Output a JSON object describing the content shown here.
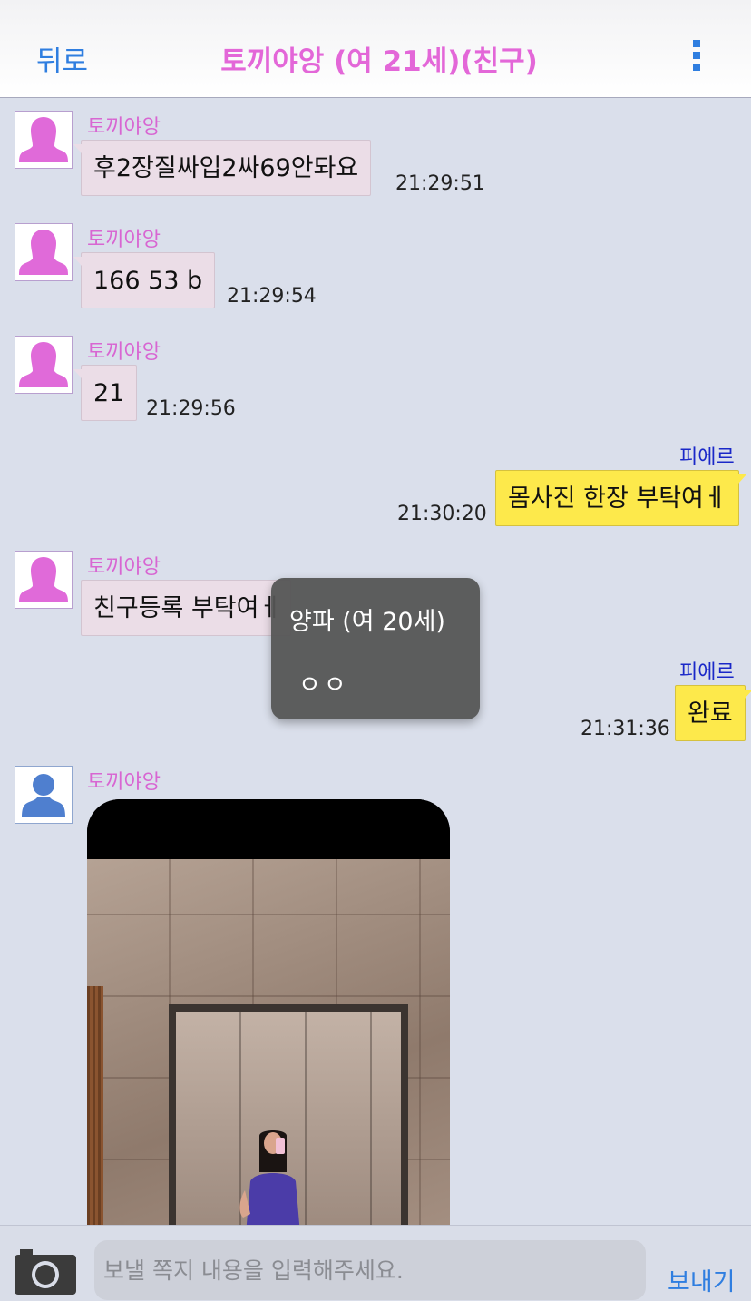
{
  "header": {
    "back_label": "뒤로",
    "title": "토끼야앙 (여 21세)(친구)",
    "menu_icon": "more-vertical-icon"
  },
  "colors": {
    "accent": "#2f7ee0",
    "partner_name": "#d866d2",
    "my_name": "#1a28c8",
    "incoming_bubble": "#ebdde7",
    "outgoing_bubble": "#fde94b"
  },
  "messages": [
    {
      "sender": "토끼야앙",
      "text": "후2장질싸입2싸69안돠요",
      "time": "21:29:51",
      "direction": "in"
    },
    {
      "sender": "토끼야앙",
      "text": "166 53 b",
      "time": "21:29:54",
      "direction": "in"
    },
    {
      "sender": "토끼야앙",
      "text": "21",
      "time": "21:29:56",
      "direction": "in"
    },
    {
      "sender": "피에르",
      "text": "몸사진 한장 부탁여ㅔ",
      "time": "21:30:20",
      "direction": "out"
    },
    {
      "sender": "토끼야앙",
      "text": "친구등록 부탁여ㅔ",
      "time": "",
      "direction": "in"
    },
    {
      "sender": "피에르",
      "text": "완료",
      "time": "21:31:36",
      "direction": "out"
    },
    {
      "sender": "토끼야앙",
      "text": "",
      "time": "",
      "direction": "in",
      "attachment": "photo"
    }
  ],
  "popup": {
    "name": "양파 (여 20세)",
    "message": "ㅇㅇ"
  },
  "composer": {
    "camera_icon": "camera-icon",
    "placeholder": "보낼 쪽지 내용을 입력해주세요.",
    "send_label": "보내기"
  }
}
